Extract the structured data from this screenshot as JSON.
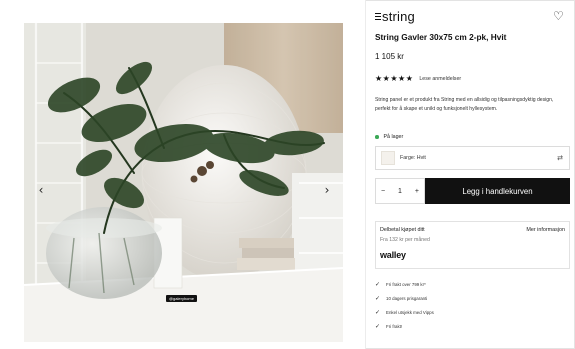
{
  "gallery": {
    "prev_icon": "chevron-left-icon",
    "next_icon": "chevron-right-icon",
    "prev_glyph": "‹",
    "next_glyph": "›",
    "photo_credit": "@galeryhome"
  },
  "product": {
    "brand": "string",
    "wishlist_glyph": "♡",
    "title": "String Gavler 30x75 cm 2-pk, Hvit",
    "price": "1 105 kr",
    "rating_stars": 5,
    "star_glyph": "★",
    "reviews_link": "Lese anmeldelser",
    "description": "String panel er et produkt fra String med en allsidig og tilpasningsdyktig design, perfekt for å skape et unikt og funksjonelt hyllesystem.",
    "stock_status": "På lager",
    "stock_color": "#3aa856",
    "color_option": "Farge: Hvit",
    "swap_glyph": "⇄"
  },
  "purchase": {
    "minus": "−",
    "quantity": "1",
    "plus": "+",
    "add_to_cart": "Legg i handlekurven"
  },
  "financing": {
    "title": "Delbetal kjøpet ditt",
    "more_info": "Mer informasjon",
    "from_price": "Fra 132 kr per måned",
    "provider": "walley"
  },
  "usps": [
    "Fri frakt over 799 kr*",
    "10 dagers prisgaranti",
    "Enkel utsjekk med Vipps",
    "Fri frakt!"
  ],
  "check_glyph": "✓"
}
